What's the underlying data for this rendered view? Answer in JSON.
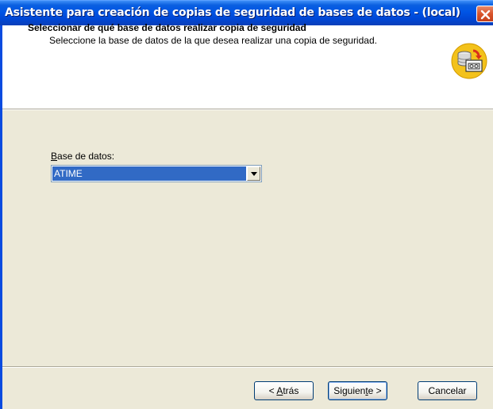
{
  "window": {
    "title": "Asistente para creación de copias de seguridad de bases de datos - (local)"
  },
  "header": {
    "title": "Seleccionar de qué base de datos realizar copia de seguridad",
    "subtitle": "Seleccione la base de datos de la que desea realizar una copia de seguridad.",
    "icon": "database-backup-icon"
  },
  "form": {
    "db_label_mnemonic": "B",
    "db_label_rest": "ase de datos:",
    "db_selected": "ATIME"
  },
  "buttons": {
    "back_prefix": "< ",
    "back_mnemonic": "A",
    "back_rest": "trás",
    "next_prefix": "Siguien",
    "next_mnemonic": "t",
    "next_rest": "e >",
    "cancel": "Cancelar"
  },
  "colors": {
    "titlebar": "#0055e5",
    "selection": "#316ac5",
    "dialog_bg": "#ece9d8",
    "close_button": "#d9542b"
  }
}
